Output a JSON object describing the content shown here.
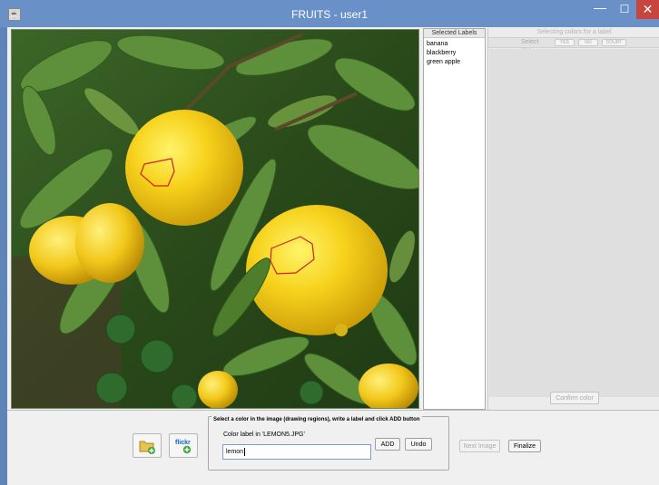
{
  "window": {
    "title": "FRUITS - user1",
    "minimize_glyph": "—",
    "maximize_glyph": "☐",
    "close_glyph": "✕",
    "title_bar_color": "#6a90c8",
    "close_button_color": "#c7453e"
  },
  "image": {
    "description_icon": "lemon-tree-photo",
    "annotation_stroke_color": "#d02020",
    "annotated_regions": 2
  },
  "labels_panel": {
    "header": "Selected Labels",
    "items": [
      "banana",
      "blackberry",
      "green apple"
    ]
  },
  "colors_panel": {
    "title": "Selecting colors for a label",
    "select_all": "Select ALL",
    "yes": "YES",
    "no": "NO",
    "doubt": "DOUBT",
    "confirm_button": "Confirm color"
  },
  "bottom": {
    "open_folder_icon": "add-folder-icon",
    "flickr_icon": "flickr-add-icon",
    "flickr_text": "flickr",
    "group_legend": "Select a color in the image (drawing regions), write a label and click ADD button",
    "color_label_text": "Color label in 'LEMON5.JPG'",
    "input_value": "lemon",
    "add_button": "ADD",
    "undo_button": "Undo",
    "next_image_button": "Next Image",
    "finalize_button": "Finalize"
  }
}
